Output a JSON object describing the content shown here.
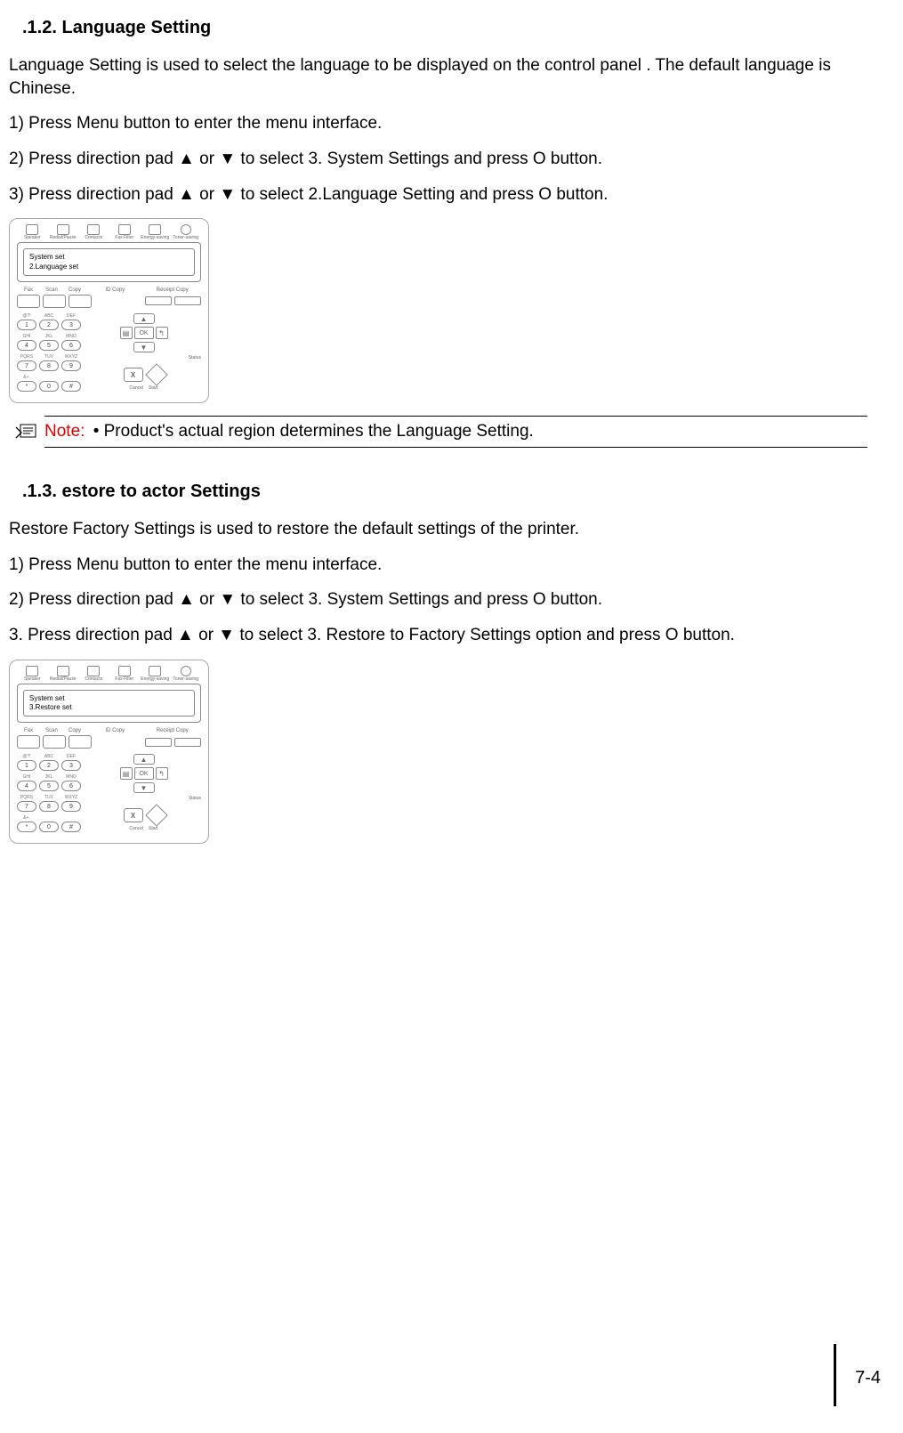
{
  "section1": {
    "heading": ".1.2. Language Setting",
    "p1": " Language Setting  is used to select the language to be displayed on the control panel . The default language is Chinese.",
    "step1": "1) Press  Menu  button to enter the menu interface.",
    "step2": "2) Press direction pad  ▲  or  ▼  to select  3. System Settings  and press  O     button.",
    "step3": "3) Press direction pad  ▲  or  ▼  to select  2.Language Setting  and press  O     button.",
    "note_label": "Note:",
    "note_text": " • Product's actual region determines the Language Setting."
  },
  "section2": {
    "heading": ".1.3.    estore to   actor   Settings",
    "p1": " Restore Factory Settings  is used to restore the default settings of the printer.",
    "step1": "1) Press  Menu  button to enter the menu interface.",
    "step2": "2) Press direction pad  ▲  or  ▼  to select  3. System Settings  and press  O     button.",
    "step3": "3. Press direction pad  ▲  or  ▼  to select  3. Restore to Factory Settings  option and press  O     button."
  },
  "panel": {
    "topicons": [
      "Speaker",
      "Redial/Pause",
      "Contacts",
      "Fax Filter",
      "Energy-saving",
      "Toner-saving"
    ],
    "lcd1_line1": "System set",
    "lcd1_line2": "2.Language set",
    "lcd2_line1": "System set",
    "lcd2_line2": "3.Restore set",
    "modes_fax": "Fax",
    "modes_scan": "Scan",
    "modes_copy": "Copy",
    "modes_idcopy": "ID Copy",
    "modes_receipt": "Receipt Copy",
    "keypad": [
      [
        "1",
        "2",
        "3"
      ],
      [
        "4",
        "5",
        "6"
      ],
      [
        "7",
        "8",
        "9"
      ],
      [
        "*",
        "0",
        "#"
      ]
    ],
    "keylabels_row1": [
      "@?!",
      "ABC",
      "DEF"
    ],
    "keylabels_row2": [
      "GHI",
      "JKL",
      "MNO"
    ],
    "keylabels_row3": [
      "PQRS",
      "TUV",
      "WXYZ"
    ],
    "keylabels_row4": [
      "&+.",
      "",
      ""
    ],
    "arrow_up": "▲",
    "arrow_down": "▼",
    "ok": "OK",
    "back": "↰",
    "menu_icon": "▤",
    "cancel": "X",
    "cancel_label": "Cancel",
    "start_label": "Start",
    "status_label": "Status"
  },
  "page_number": "7-4"
}
